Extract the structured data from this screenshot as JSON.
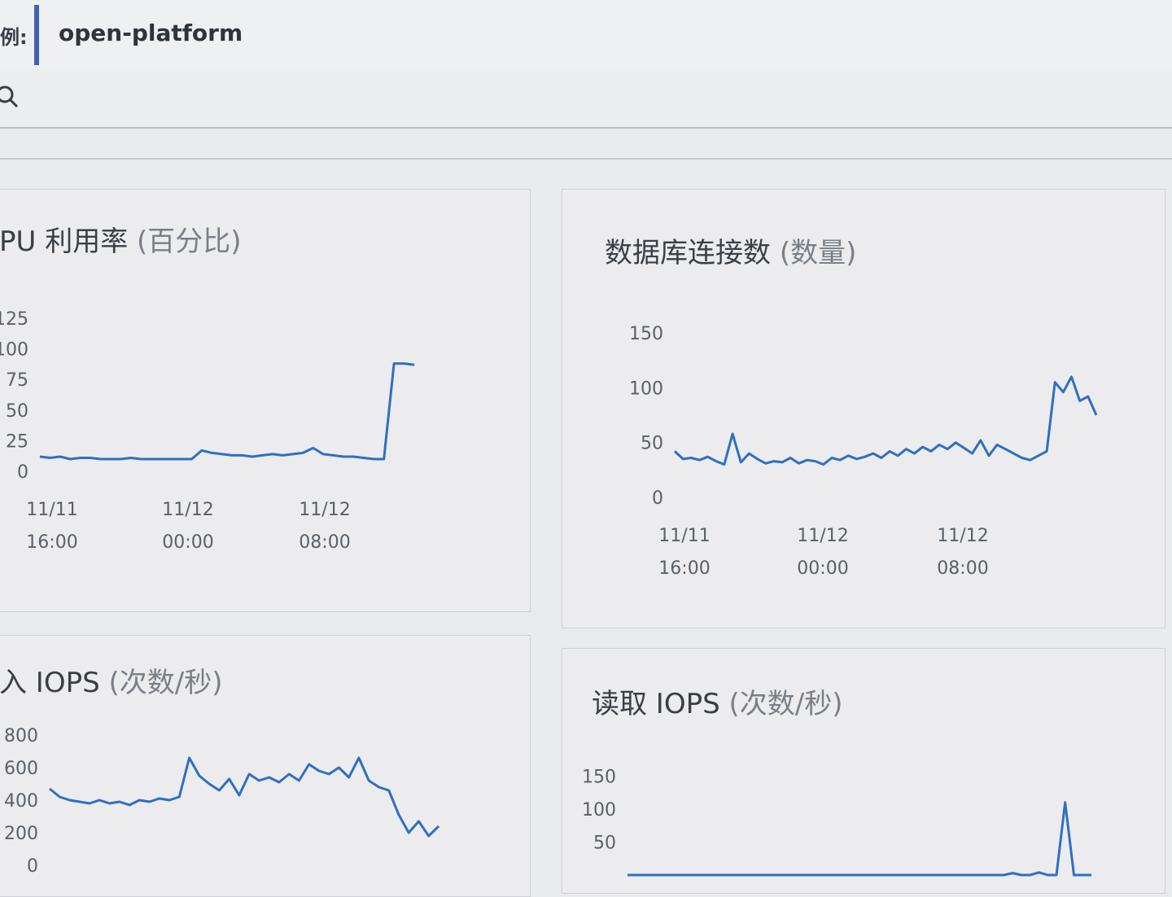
{
  "header": {
    "instance_label": "例:",
    "instance_name": "open-platform"
  },
  "search": {
    "icon": "search-icon"
  },
  "colors": {
    "series": "#2f6fc2",
    "accent_bar": "#3e65ad"
  },
  "panels": [
    {
      "id": "cpu",
      "title": "PU 利用率",
      "unit": "(百分比)"
    },
    {
      "id": "conn",
      "title": "数据库连接数",
      "unit": "(数量)"
    },
    {
      "id": "write",
      "title": "入 IOPS",
      "unit": "(次数/秒)"
    },
    {
      "id": "read",
      "title": "读取 IOPS",
      "unit": "(次数/秒)"
    }
  ],
  "chart_data": [
    {
      "type": "line",
      "title": "PU 利用率 (百分比)",
      "x_ticks": [
        [
          "11/11",
          "16:00"
        ],
        [
          "11/12",
          "00:00"
        ],
        [
          "11/12",
          "08:00"
        ]
      ],
      "y_ticks": [
        0,
        25,
        50,
        75,
        100,
        125
      ],
      "ylim": [
        0,
        125
      ],
      "series": [
        {
          "values": [
            12,
            11,
            12,
            10,
            11,
            11,
            10,
            10,
            10,
            11,
            10,
            10,
            10,
            10,
            10,
            10,
            17,
            15,
            14,
            13,
            13,
            12,
            13,
            14,
            13,
            14,
            15,
            19,
            14,
            13,
            12,
            12,
            11,
            10,
            10,
            88,
            88,
            87
          ]
        }
      ]
    },
    {
      "type": "line",
      "title": "数据库连接数 (数量)",
      "x_ticks": [
        [
          "11/11",
          "16:00"
        ],
        [
          "11/12",
          "00:00"
        ],
        [
          "11/12",
          "08:00"
        ]
      ],
      "y_ticks": [
        0,
        50,
        100,
        150
      ],
      "ylim": [
        0,
        150
      ],
      "series": [
        {
          "values": [
            42,
            35,
            36,
            34,
            37,
            33,
            30,
            58,
            32,
            40,
            35,
            31,
            33,
            32,
            36,
            31,
            34,
            33,
            30,
            36,
            34,
            38,
            35,
            37,
            40,
            36,
            42,
            38,
            44,
            40,
            46,
            42,
            48,
            44,
            50,
            45,
            40,
            52,
            38,
            48,
            44,
            40,
            36,
            34,
            38,
            42,
            105,
            96,
            110,
            88,
            92,
            75
          ]
        }
      ]
    },
    {
      "type": "line",
      "title": "入 IOPS (次数/秒)",
      "x_ticks": [],
      "y_ticks": [
        0,
        200,
        400,
        600,
        800
      ],
      "ylim": [
        0,
        800
      ],
      "series": [
        {
          "values": [
            470,
            420,
            400,
            390,
            380,
            400,
            380,
            390,
            370,
            400,
            390,
            410,
            400,
            420,
            660,
            550,
            500,
            460,
            530,
            430,
            560,
            520,
            540,
            510,
            560,
            520,
            620,
            580,
            560,
            600,
            540,
            660,
            520,
            480,
            460,
            310,
            200,
            270,
            180,
            240
          ]
        }
      ]
    },
    {
      "type": "line",
      "title": "读取 IOPS (次数/秒)",
      "x_ticks": [],
      "y_ticks": [
        50,
        100,
        150
      ],
      "ylim": [
        0,
        175
      ],
      "series": [
        {
          "values": [
            0,
            0,
            0,
            0,
            0,
            0,
            0,
            0,
            0,
            0,
            0,
            0,
            0,
            0,
            0,
            0,
            0,
            0,
            0,
            0,
            0,
            0,
            0,
            0,
            0,
            0,
            0,
            0,
            0,
            0,
            0,
            0,
            0,
            0,
            0,
            0,
            0,
            0,
            0,
            0,
            0,
            0,
            0,
            0,
            3,
            0,
            0,
            4,
            0,
            0,
            110,
            0,
            0,
            0
          ]
        }
      ]
    }
  ]
}
